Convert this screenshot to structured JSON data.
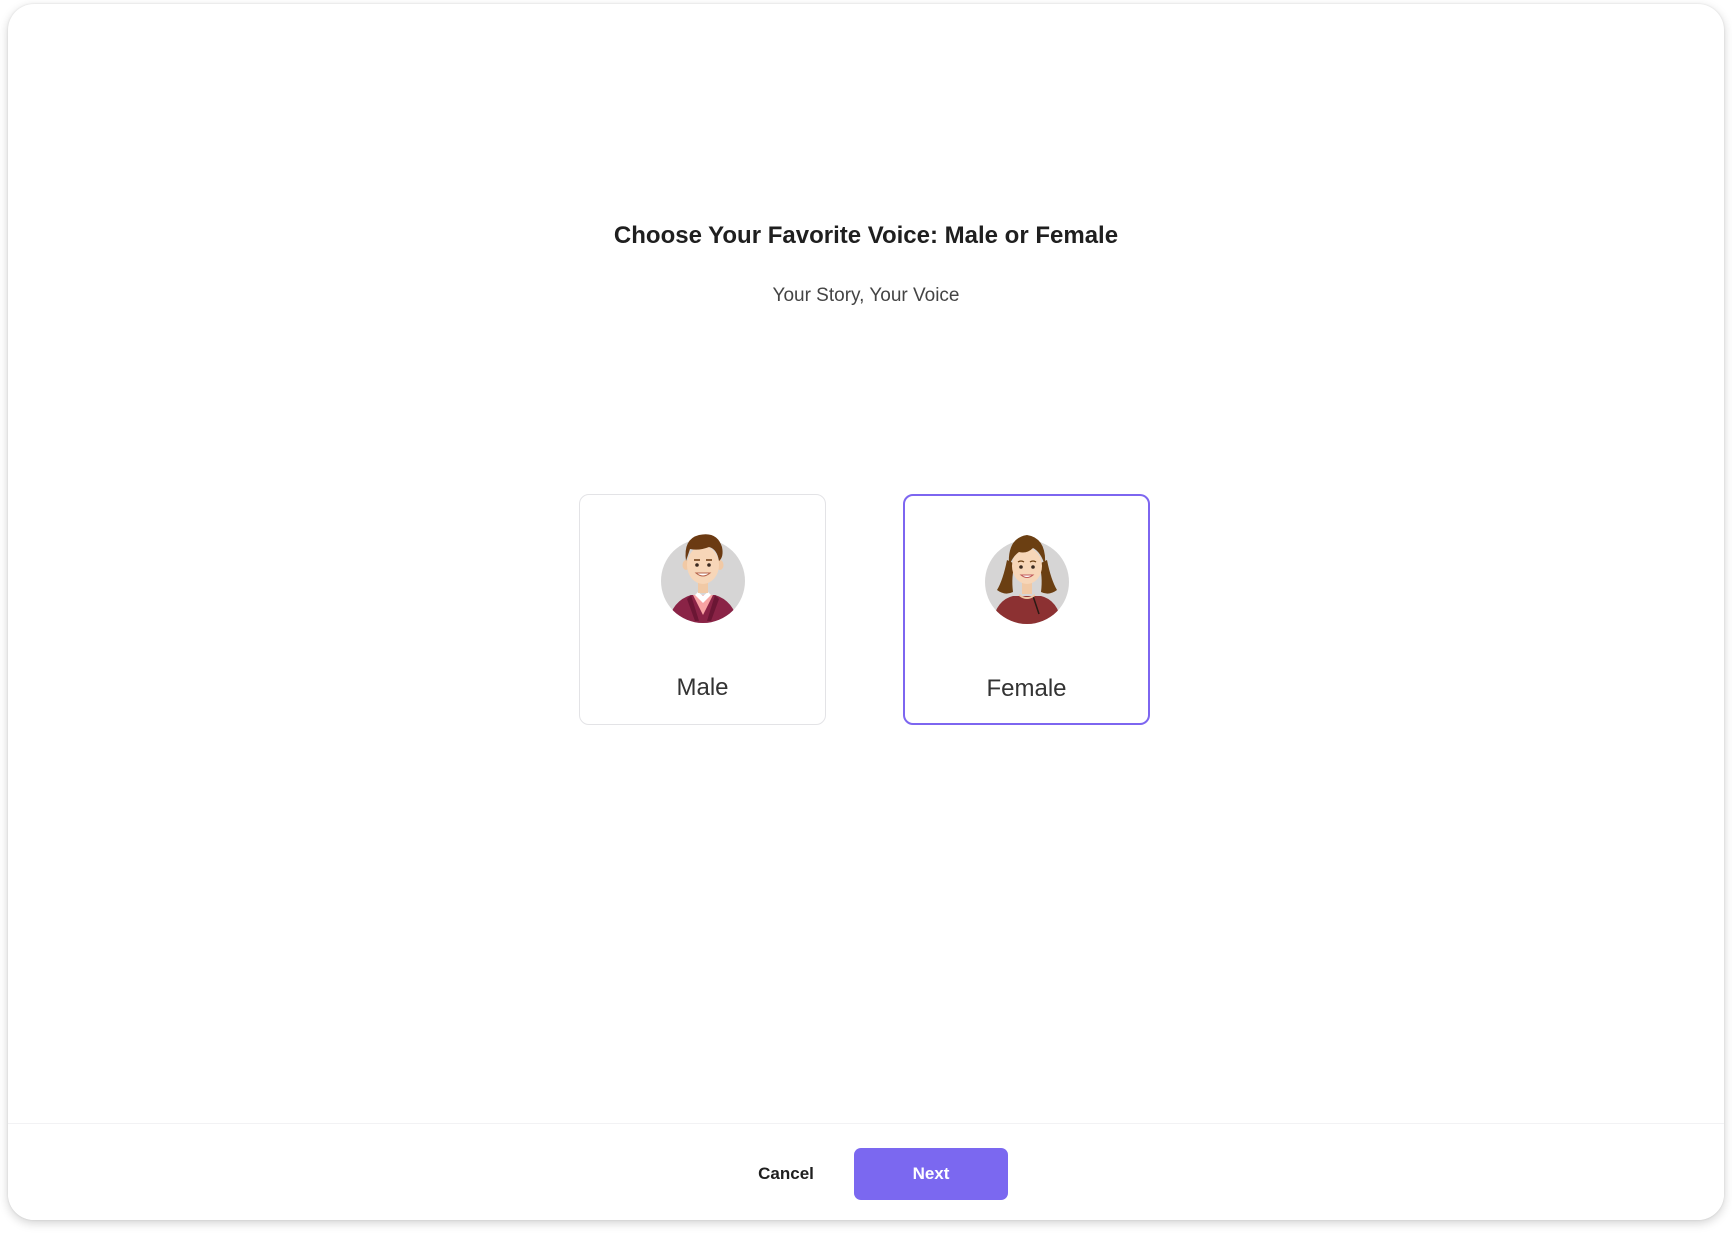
{
  "header": {
    "title": "Choose Your Favorite Voice: Male or Female",
    "subtitle": "Your Story, Your Voice"
  },
  "options": [
    {
      "label": "Male",
      "icon": "male-avatar-icon",
      "selected": false
    },
    {
      "label": "Female",
      "icon": "female-avatar-icon",
      "selected": true
    }
  ],
  "footer": {
    "cancel_label": "Cancel",
    "next_label": "Next"
  },
  "colors": {
    "accent": "#7b68f0",
    "selected_border": "#7d66f0",
    "card_border": "#e3e3e6"
  }
}
